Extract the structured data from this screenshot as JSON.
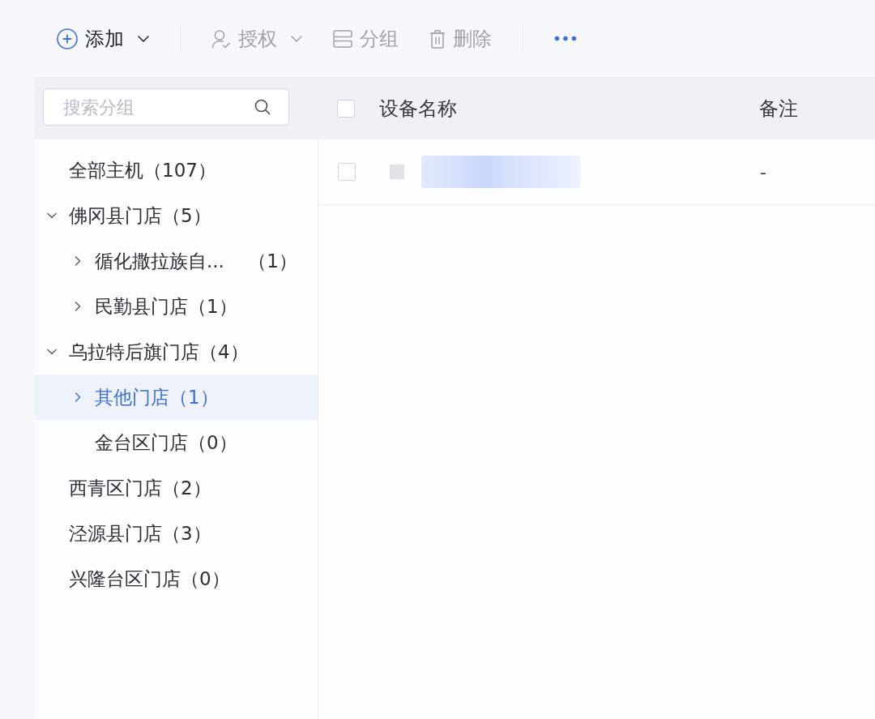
{
  "toolbar": {
    "groups": [
      [
        {
          "kind": "add",
          "label": "添加",
          "dropdown": true,
          "disabled": false
        }
      ],
      [
        {
          "kind": "authorize",
          "label": "授权",
          "dropdown": true,
          "disabled": true
        },
        {
          "kind": "group",
          "label": "分组",
          "dropdown": false,
          "disabled": true
        },
        {
          "kind": "delete",
          "label": "删除",
          "dropdown": false,
          "disabled": true
        }
      ],
      [
        {
          "kind": "more",
          "disabled": false
        }
      ]
    ]
  },
  "sidebar": {
    "search": {
      "placeholder": "搜索分组"
    },
    "tree": [
      {
        "kind": "leaf",
        "label": "全部主机（107）",
        "selected": false
      },
      {
        "kind": "group",
        "label": "佛冈县门店（5）",
        "expanded": true,
        "selected": false,
        "children": [
          {
            "kind": "group",
            "label": "循化撒拉族自...    （1）",
            "expanded": false,
            "selected": false
          },
          {
            "kind": "group",
            "label": "民勤县门店（1）",
            "expanded": false,
            "selected": false
          }
        ]
      },
      {
        "kind": "group",
        "label": "乌拉特后旗门店（4）",
        "expanded": true,
        "selected": false,
        "children": [
          {
            "kind": "group",
            "label": "其他门店（1）",
            "expanded": false,
            "selected": true
          },
          {
            "kind": "leaf",
            "label": "金台区门店（0）",
            "selected": false
          }
        ]
      },
      {
        "kind": "leaf",
        "label": "西青区门店（2）",
        "selected": false
      },
      {
        "kind": "leaf",
        "label": "泾源县门店（3）",
        "selected": false
      },
      {
        "kind": "leaf",
        "label": "兴隆台区门店（0）",
        "selected": false
      }
    ]
  },
  "table": {
    "select_all": {
      "checked": false
    },
    "columns": [
      "设备名称",
      "备注"
    ],
    "rows": [
      {
        "checked": false,
        "note": "-"
      }
    ]
  }
}
